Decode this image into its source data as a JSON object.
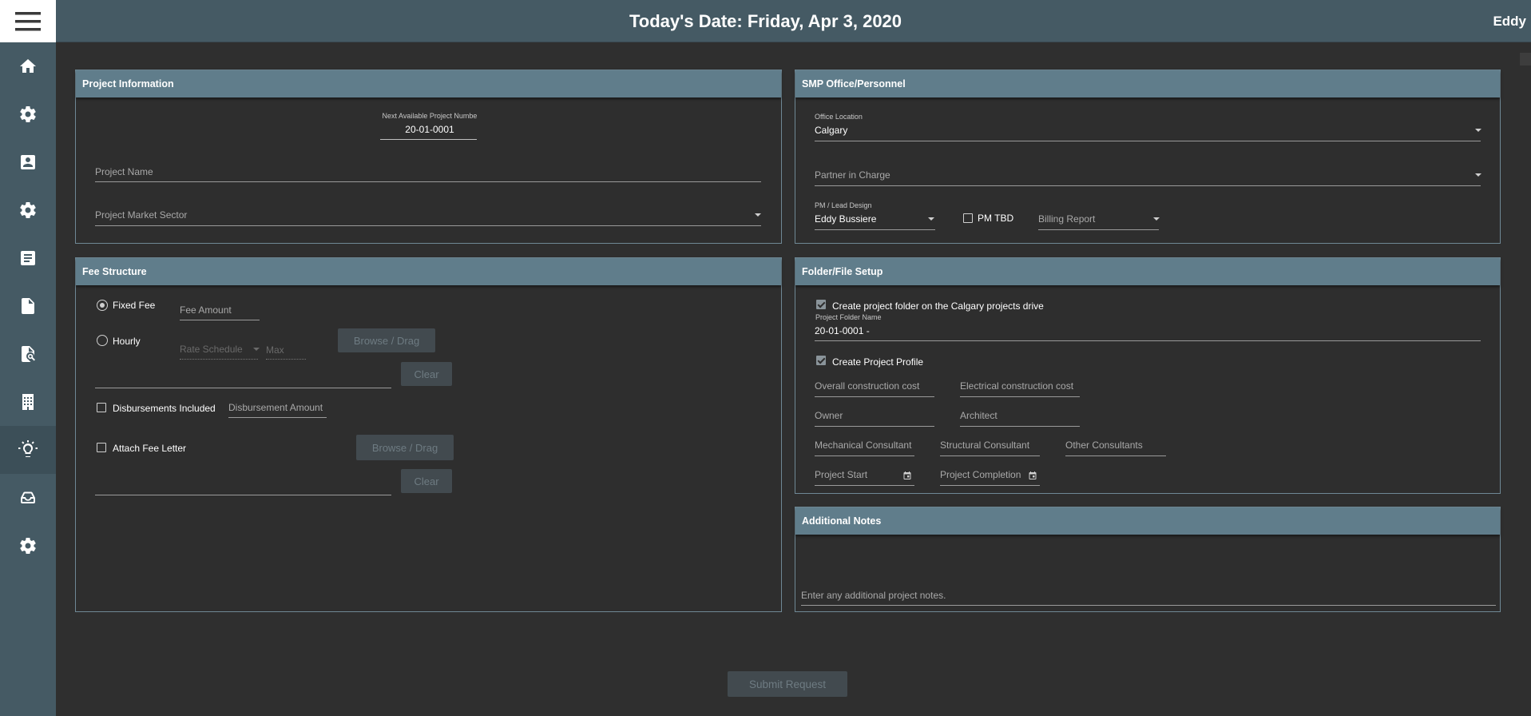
{
  "header": {
    "title": "Today's Date: Friday, Apr 3, 2020",
    "user": "Eddy"
  },
  "sidebar": {
    "items": [
      {
        "icon": "home-icon"
      },
      {
        "icon": "gear-icon"
      },
      {
        "icon": "contact-card-icon"
      },
      {
        "icon": "gear-icon"
      },
      {
        "icon": "article-icon"
      },
      {
        "icon": "file-icon"
      },
      {
        "icon": "file-search-icon"
      },
      {
        "icon": "building-icon"
      },
      {
        "icon": "lightbulb-icon"
      },
      {
        "icon": "inbox-tray-icon"
      },
      {
        "icon": "gear-icon"
      }
    ]
  },
  "project_info": {
    "title": "Project Information",
    "project_number_label": "Next Available Project Numbe",
    "project_number_value": "20-01-0001",
    "project_name_placeholder": "Project Name",
    "market_sector_placeholder": "Project Market Sector"
  },
  "office": {
    "title": "SMP Office/Personnel",
    "office_location_label": "Office Location",
    "office_location_value": "Calgary",
    "partner_placeholder": "Partner in Charge",
    "pm_label": "PM / Lead Design",
    "pm_value": "Eddy Bussiere",
    "pm_tbd_label": "PM TBD",
    "pm_tbd_checked": false,
    "billing_placeholder": "Billing Report"
  },
  "fee": {
    "title": "Fee Structure",
    "fixed_fee_label": "Fixed Fee",
    "fixed_fee_selected": true,
    "fee_amount_placeholder": "Fee Amount",
    "hourly_label": "Hourly",
    "rate_schedule_placeholder": "Rate Schedule",
    "max_placeholder": "Max",
    "browse_label": "Browse / Drag",
    "clear_label": "Clear",
    "disbursements_label": "Disbursements Included",
    "disbursement_amount_placeholder": "Disbursement Amount",
    "attach_fee_letter_label": "Attach Fee Letter",
    "browse2_label": "Browse / Drag",
    "clear2_label": "Clear"
  },
  "folder": {
    "title": "Folder/File Setup",
    "create_folder_label": "Create project folder on the Calgary projects drive",
    "create_folder_checked": true,
    "folder_name_label": "Project Folder Name",
    "folder_name_value": "20-01-0001 -",
    "create_profile_label": "Create Project Profile",
    "create_profile_checked": true,
    "overall_cost_placeholder": "Overall construction cost",
    "electrical_cost_placeholder": "Electrical construction cost",
    "owner_placeholder": "Owner",
    "architect_placeholder": "Architect",
    "mechanical_placeholder": "Mechanical Consultant",
    "structural_placeholder": "Structural Consultant",
    "other_placeholder": "Other Consultants",
    "start_placeholder": "Project Start",
    "completion_placeholder": "Project Completion"
  },
  "notes": {
    "title": "Additional Notes",
    "placeholder": "Enter any additional project notes."
  },
  "submit_label": "Submit Request"
}
